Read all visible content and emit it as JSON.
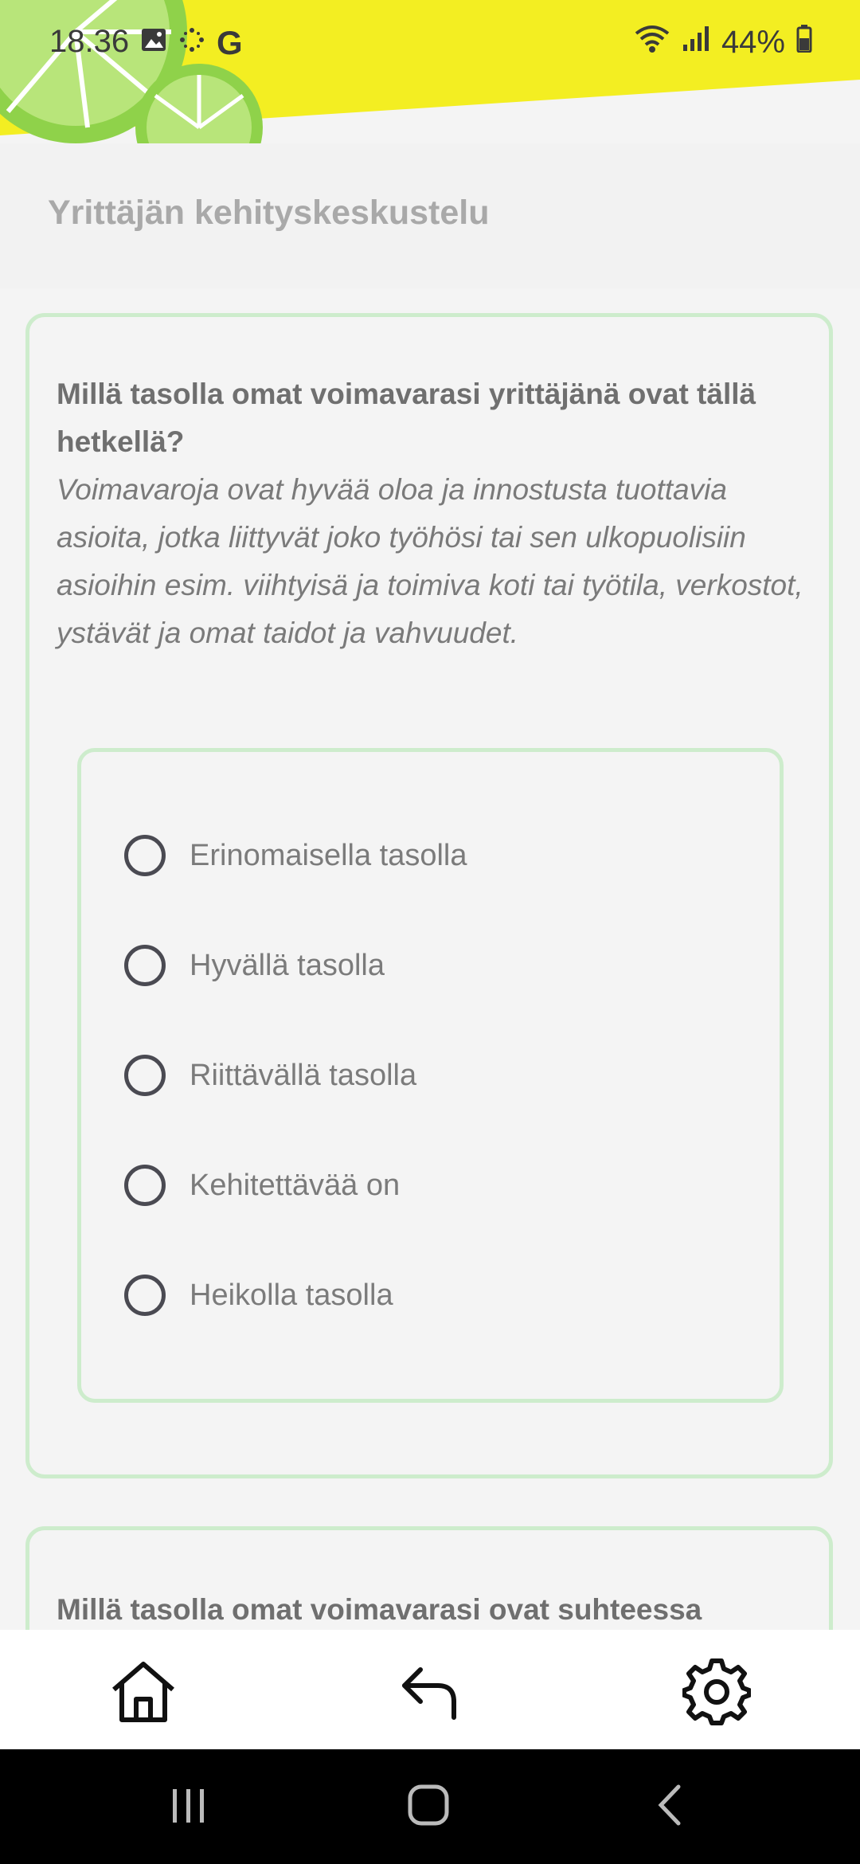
{
  "status_bar": {
    "time": "18.36",
    "battery": "44%",
    "icons": [
      "image-icon",
      "sparkle-icon",
      "google-icon",
      "wifi-icon",
      "signal-icon",
      "battery-icon"
    ],
    "google_letter": "G"
  },
  "header": {
    "title": "Yrittäjän kehityskeskustelu",
    "colors": {
      "yellow": "#f3ee22",
      "green": "#8fd24a"
    }
  },
  "question1": {
    "title": "Millä tasolla omat voimavarasi yrittäjänä ovat tällä hetkellä?",
    "description": "Voimavaroja ovat hyvää oloa ja innostusta tuottavia asioita, jotka liittyvät joko työhösi tai sen ulkopuolisiin asioihin esim. viihtyisä ja toimiva koti tai työtila, verkostot, ystävät ja omat taidot ja vahvuudet.",
    "options": [
      "Erinomaisella tasolla",
      "Hyvällä tasolla",
      "Riittävällä tasolla",
      "Kehitettävää on",
      "Heikolla tasolla"
    ]
  },
  "question2": {
    "title": "Millä tasolla omat voimavarasi ovat suhteessa"
  },
  "bottom_nav": {
    "items": [
      "home-icon",
      "reply-icon",
      "gear-icon"
    ]
  },
  "system_nav": {
    "items": [
      "recents-icon",
      "home-circle-icon",
      "back-icon"
    ]
  },
  "accent_color": "#cdeccc"
}
